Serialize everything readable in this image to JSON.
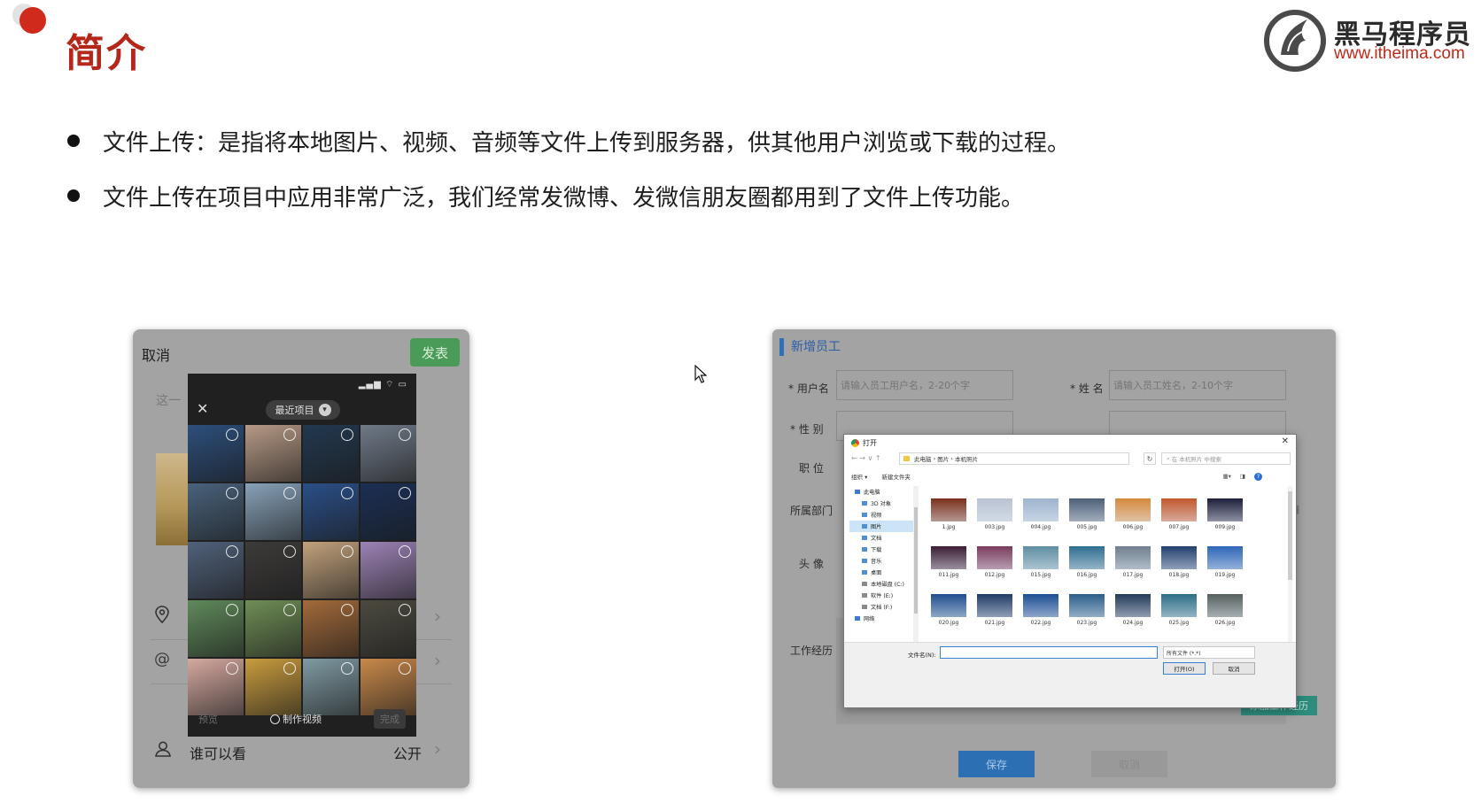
{
  "slide": {
    "title": "简介",
    "brand_name": "黑马程序员",
    "brand_url": "www.itheima.com",
    "accent": "#b5261b",
    "bullets": [
      "文件上传：是指将本地图片、视频、音频等文件上传到服务器，供其他用户浏览或下载的过程。",
      "文件上传在项目中应用非常广泛，我们经常发微博、发微信朋友圈都用到了文件上传功能。"
    ]
  },
  "phone": {
    "cancel_label": "取消",
    "publish_label": "发表",
    "publish_color": "#4a9b57",
    "placeholder_fragment": "这一",
    "visibility_label": "谁可以看",
    "visibility_value": "公开",
    "icons": [
      "location-icon",
      "at-icon",
      "person-icon"
    ],
    "picker": {
      "album_label": "最近项目",
      "preview_label": "预览",
      "make_video_label": "制作视频",
      "done_label": "完成",
      "photos": [
        "#2c4f7c",
        "#b79a86",
        "#22384f",
        "#6f7a88",
        "#49627c",
        "#88a2b9",
        "#2a4f88",
        "#1b2f55",
        "#50617a",
        "#3d3b3a",
        "#c2a27c",
        "#9d83b6",
        "#5f8a5a",
        "#6f8e55",
        "#a36a3a",
        "#4c4a3f",
        "#d5a9a0",
        "#c99c3e",
        "#7f9aa2",
        "#c9894a"
      ]
    }
  },
  "form": {
    "title": "新增员工",
    "fields": {
      "username_label": "* 用户名",
      "username_placeholder": "请输入员工用户名，2-20个字",
      "name_label": "* 姓  名",
      "name_placeholder": "请输入员工姓名，2-10个字",
      "gender_label": "* 性  别",
      "position_label": "职  位",
      "department_label": "所属部门",
      "avatar_label": "头  像",
      "experience_label": "工作经历"
    },
    "add_experience_label": "添加工作经历",
    "save_label": "保存",
    "cancel_label": "取消"
  },
  "dialog": {
    "title": "打开",
    "path": [
      "此电脑",
      "图片",
      "本机照片"
    ],
    "search_placeholder": "在 本机照片 中搜索",
    "organize_label": "组织 ▾",
    "new_folder_label": "新建文件夹",
    "sidebar": [
      "此电脑",
      "3D 对象",
      "视频",
      "图片",
      "文档",
      "下载",
      "音乐",
      "桌面",
      "本地磁盘 (C:)",
      "软件 (E:)",
      "文档 (F:)",
      "网络"
    ],
    "sidebar_selected": "图片",
    "files": [
      {
        "name": "1.jpg",
        "color": "#7a2f1a"
      },
      {
        "name": "003.jpg",
        "color": "#b9c3d2"
      },
      {
        "name": "004.jpg",
        "color": "#9fb4cf"
      },
      {
        "name": "005.jpg",
        "color": "#4d5f78"
      },
      {
        "name": "006.jpg",
        "color": "#d68a3d"
      },
      {
        "name": "007.jpg",
        "color": "#c2572c"
      },
      {
        "name": "009.jpg",
        "color": "#1d1e3a"
      },
      {
        "name": "011.jpg",
        "color": "#3b1c34"
      },
      {
        "name": "012.jpg",
        "color": "#7b3b5d"
      },
      {
        "name": "015.jpg",
        "color": "#5f8fa2"
      },
      {
        "name": "016.jpg",
        "color": "#2f6e8f"
      },
      {
        "name": "017.jpg",
        "color": "#6e7f8f"
      },
      {
        "name": "018.jpg",
        "color": "#22406e"
      },
      {
        "name": "019.jpg",
        "color": "#2d66b8"
      },
      {
        "name": "020.jpg",
        "color": "#1f4f8e"
      },
      {
        "name": "021.jpg",
        "color": "#203b66"
      },
      {
        "name": "022.jpg",
        "color": "#1c4e93"
      },
      {
        "name": "023.jpg",
        "color": "#2b5e8a"
      },
      {
        "name": "024.jpg",
        "color": "#233a5a"
      },
      {
        "name": "025.jpg",
        "color": "#2c6e86"
      },
      {
        "name": "026.jpg",
        "color": "#56615f"
      }
    ],
    "filename_label": "文件名(N):",
    "filetype_value": "所有文件 (*.*)",
    "open_label": "打开(O)",
    "cancel_label": "取消"
  }
}
